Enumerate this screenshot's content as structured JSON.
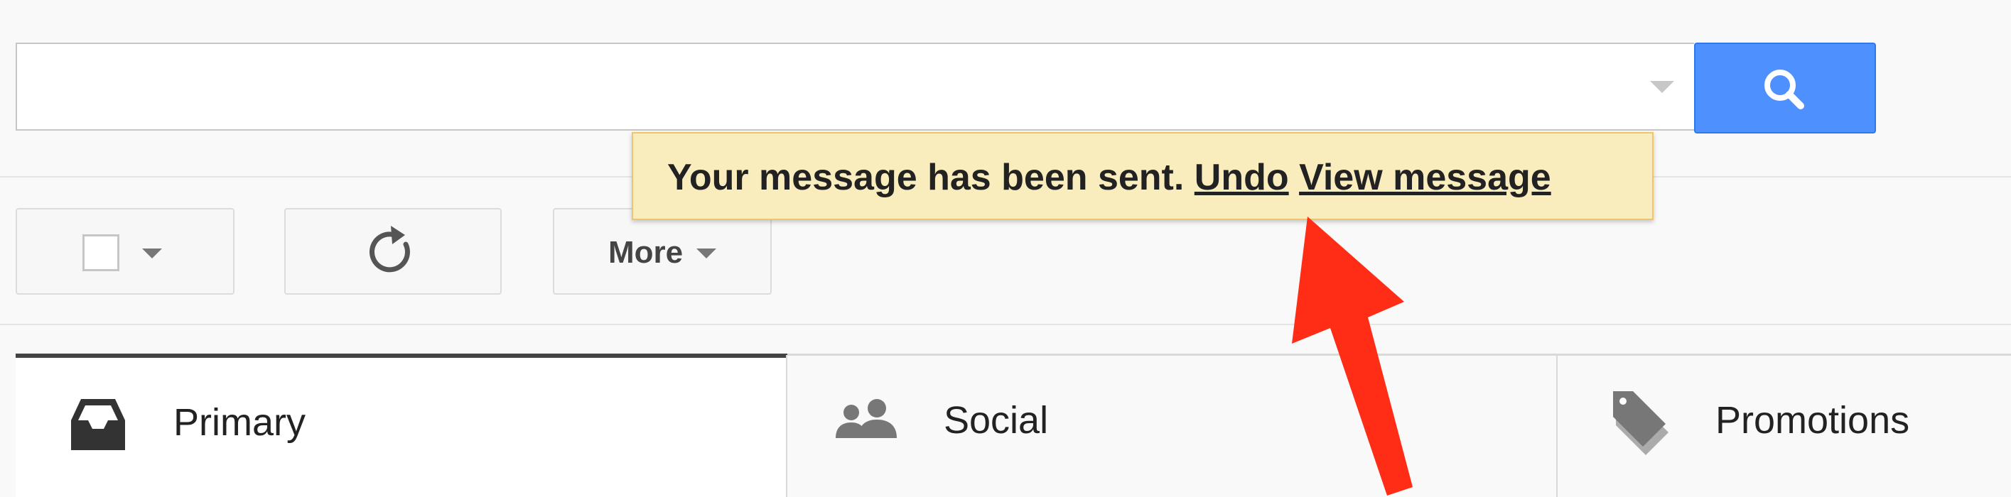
{
  "search": {
    "value": "",
    "placeholder": "",
    "search_icon": "magnifier-icon",
    "dropdown_icon": "caret-down-icon",
    "button_color": "#4d90fe"
  },
  "toolbar": {
    "select_icon": "checkbox-icon",
    "refresh_icon": "refresh-icon",
    "more_label": "More"
  },
  "notification": {
    "message": "Your message has been sent.",
    "undo_label": "Undo",
    "view_label": "View message",
    "background_color": "#f9edbe"
  },
  "tabs": [
    {
      "label": "Primary",
      "icon": "inbox-icon",
      "active": true
    },
    {
      "label": "Social",
      "icon": "people-icon",
      "active": false
    },
    {
      "label": "Promotions",
      "icon": "tag-icon",
      "active": false
    }
  ],
  "annotation": {
    "arrow_color": "#ff2d16",
    "arrow_icon": "pointer-arrow-icon"
  }
}
